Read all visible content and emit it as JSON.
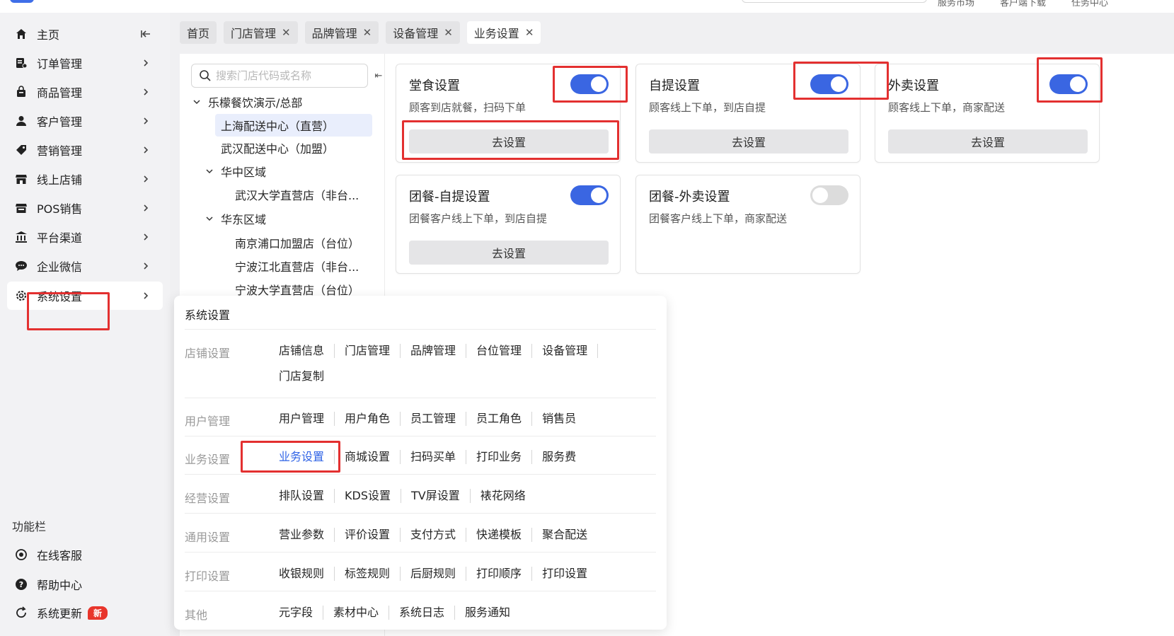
{
  "top": {
    "links": [
      "服务市场",
      "客户端下载",
      "任务中心"
    ]
  },
  "sidebar": {
    "items": [
      {
        "label": "主页",
        "icon": "home-icon"
      },
      {
        "label": "订单管理",
        "icon": "order-icon"
      },
      {
        "label": "商品管理",
        "icon": "product-icon"
      },
      {
        "label": "客户管理",
        "icon": "customer-icon"
      },
      {
        "label": "营销管理",
        "icon": "tag-icon"
      },
      {
        "label": "线上店铺",
        "icon": "store-icon"
      },
      {
        "label": "POS销售",
        "icon": "pos-icon"
      },
      {
        "label": "平台渠道",
        "icon": "bank-icon"
      },
      {
        "label": "企业微信",
        "icon": "chat-icon"
      },
      {
        "label": "系统设置",
        "icon": "gear-icon"
      }
    ],
    "section_label": "功能栏",
    "functions": [
      {
        "label": "在线客服",
        "icon": "support-icon"
      },
      {
        "label": "帮助中心",
        "icon": "help-icon"
      },
      {
        "label": "系统更新",
        "icon": "refresh-icon",
        "badge": "新"
      }
    ]
  },
  "tabs": [
    {
      "label": "首页",
      "closable": false
    },
    {
      "label": "门店管理",
      "closable": true
    },
    {
      "label": "品牌管理",
      "closable": true
    },
    {
      "label": "设备管理",
      "closable": true
    },
    {
      "label": "业务设置",
      "closable": true,
      "active": true
    }
  ],
  "tree": {
    "search_placeholder": "搜索门店代码或名称",
    "nodes": [
      {
        "label": "乐檬餐饮演示/总部",
        "level": 0,
        "expanded": true
      },
      {
        "label": "上海配送中心（直营）",
        "level": 1,
        "selected": true
      },
      {
        "label": "武汉配送中心（加盟）",
        "level": 1
      },
      {
        "label": "华中区域",
        "level": 1,
        "expanded": true
      },
      {
        "label": "武汉大学直营店（非台...",
        "level": 2
      },
      {
        "label": "华东区域",
        "level": 1,
        "expanded": true
      },
      {
        "label": "南京浦口加盟店（台位）",
        "level": 2
      },
      {
        "label": "宁波江北直营店（非台...",
        "level": 2
      },
      {
        "label": "宁波大学直营店（台位）",
        "level": 2
      }
    ]
  },
  "cards": [
    {
      "title": "堂食设置",
      "desc": "顾客到店就餐，扫码下单",
      "button": "去设置",
      "enabled": true
    },
    {
      "title": "自提设置",
      "desc": "顾客线上下单，到店自提",
      "button": "去设置",
      "enabled": true
    },
    {
      "title": "外卖设置",
      "desc": "顾客线上下单，商家配送",
      "button": "去设置",
      "enabled": true
    },
    {
      "title": "团餐-自提设置",
      "desc": "团餐客户线上下单，到店自提",
      "button": "去设置",
      "enabled": true
    },
    {
      "title": "团餐-外卖设置",
      "desc": "团餐客户线上下单，商家配送",
      "button": "",
      "enabled": false
    }
  ],
  "menu": {
    "title": "系统设置",
    "groups": [
      {
        "category": "店铺设置",
        "links": [
          "店铺信息",
          "门店管理",
          "品牌管理",
          "台位管理",
          "设备管理",
          "门店复制"
        ]
      },
      {
        "category": "用户管理",
        "links": [
          "用户管理",
          "用户角色",
          "员工管理",
          "员工角色",
          "销售员"
        ]
      },
      {
        "category": "业务设置",
        "links": [
          "业务设置",
          "商城设置",
          "扫码买单",
          "打印业务",
          "服务费"
        ],
        "current": "业务设置"
      },
      {
        "category": "经营设置",
        "links": [
          "排队设置",
          "KDS设置",
          "TV屏设置",
          "裱花网络"
        ]
      },
      {
        "category": "通用设置",
        "links": [
          "营业参数",
          "评价设置",
          "支付方式",
          "快递模板",
          "聚合配送"
        ]
      },
      {
        "category": "打印设置",
        "links": [
          "收银规则",
          "标签规则",
          "后厨规则",
          "打印顺序",
          "打印设置"
        ]
      },
      {
        "category": "其他",
        "links": [
          "元字段",
          "素材中心",
          "系统日志",
          "服务通知"
        ]
      }
    ]
  },
  "colors": {
    "accent": "#3a66e2",
    "highlight": "#e33030",
    "badge": "#e8352b"
  }
}
